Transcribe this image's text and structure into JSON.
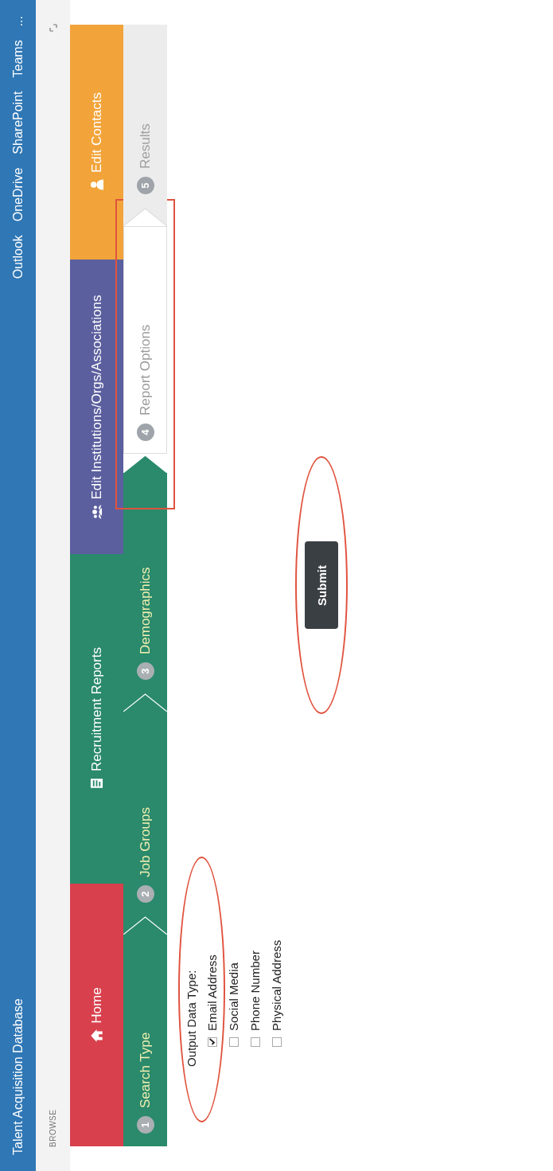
{
  "window": {
    "title": "Talent Acquisition Database"
  },
  "top_links": [
    "Outlook",
    "OneDrive",
    "SharePoint",
    "Teams",
    "..."
  ],
  "ribbon": {
    "label": "BROWSE"
  },
  "nav_tiles": [
    {
      "label": "Home",
      "kind": "home",
      "color": "#d8404d"
    },
    {
      "label": "Recruitment Reports",
      "kind": "report",
      "color": "#2a8a6b"
    },
    {
      "label": "Edit Institutions/Orgs/Associations",
      "kind": "group",
      "color": "#5b5f9e"
    },
    {
      "label": "Edit Contacts",
      "kind": "person",
      "color": "#f2a43a"
    }
  ],
  "steps": [
    {
      "number": "1",
      "label": "Search Type",
      "completed": true,
      "selected": false,
      "annotated": false
    },
    {
      "number": "2",
      "label": "Job Groups",
      "completed": true,
      "selected": false,
      "annotated": false
    },
    {
      "number": "3",
      "label": "Demographics",
      "completed": true,
      "selected": false,
      "annotated": false
    },
    {
      "number": "4",
      "label": "Report Options",
      "completed": false,
      "selected": true,
      "annotated": true
    },
    {
      "number": "5",
      "label": "Results",
      "completed": false,
      "selected": false,
      "annotated": false
    }
  ],
  "form": {
    "label": "Output Data Type:",
    "annotated": true,
    "options": [
      {
        "label": "Email Address",
        "checked": true
      },
      {
        "label": "Social Media",
        "checked": false
      },
      {
        "label": "Phone Number",
        "checked": false
      },
      {
        "label": "Physical Address",
        "checked": false
      }
    ]
  },
  "submit": {
    "label": "Submit",
    "annotated": true
  }
}
